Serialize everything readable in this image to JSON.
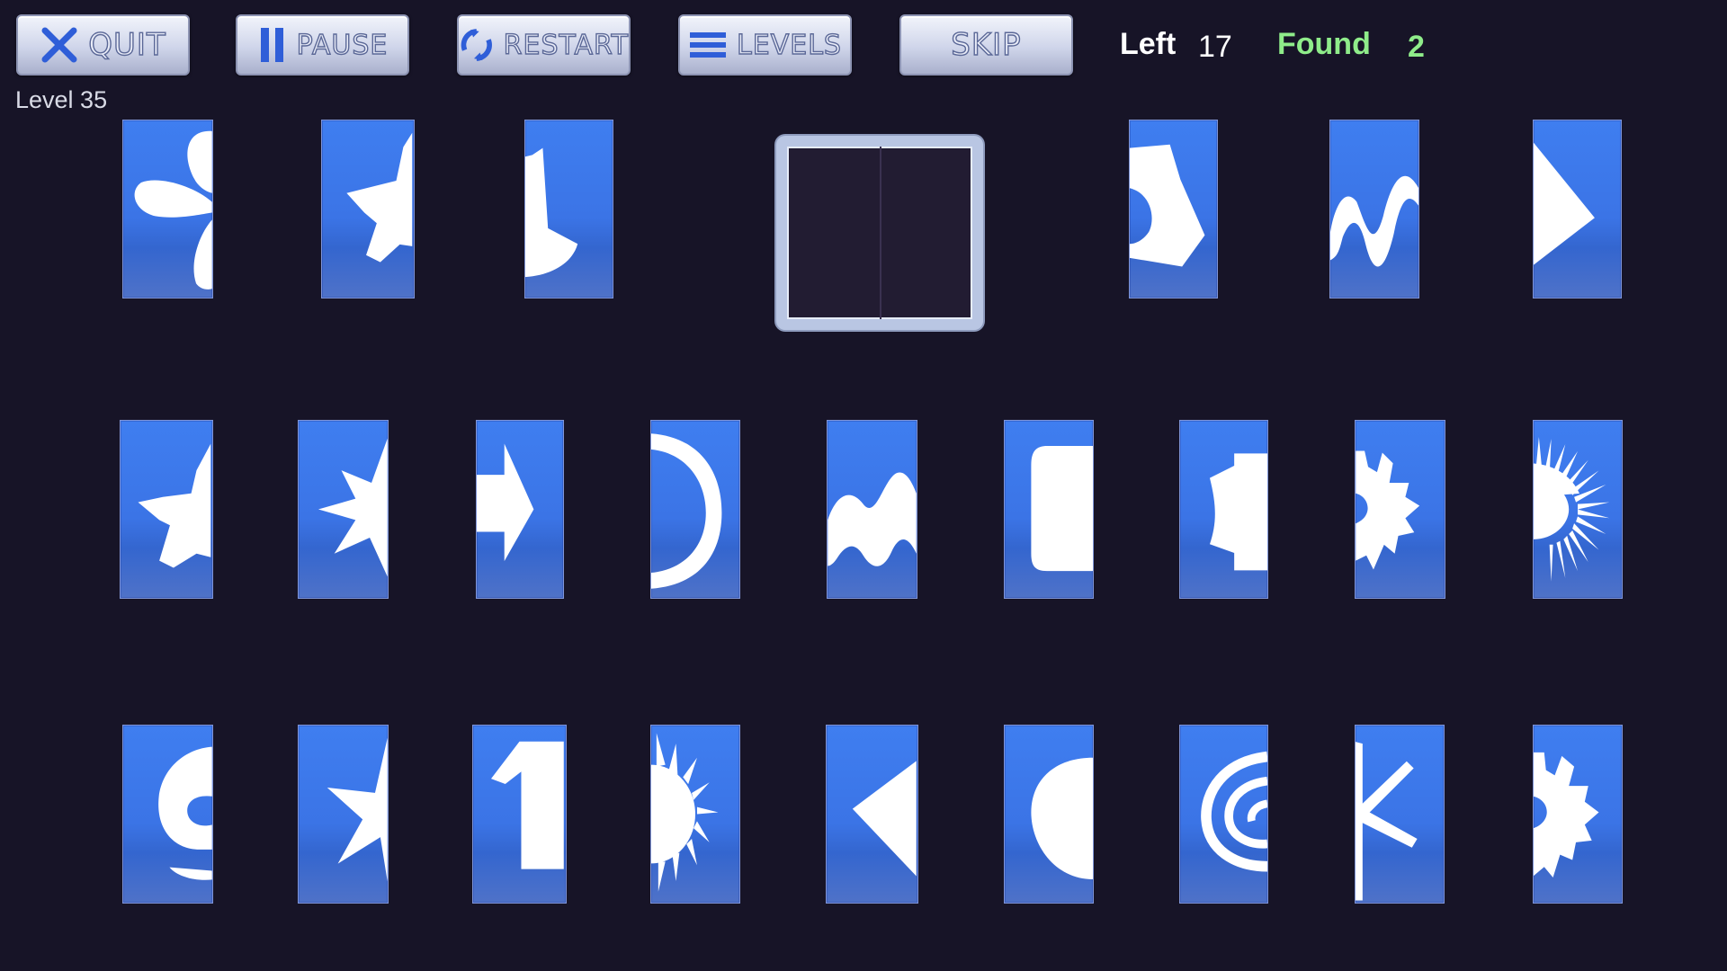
{
  "toolbar": {
    "quit_label": "QUIT",
    "pause_label": "PAUSE",
    "restart_label": "RESTART",
    "levels_label": "LEVELS",
    "skip_label": "SKIP"
  },
  "stats": {
    "left_label": "Left",
    "left_value": "17",
    "found_label": "Found",
    "found_value": "2"
  },
  "level_label": "Level 35",
  "colors": {
    "background": "#171427",
    "tile_blue": "#3b74e6",
    "found_green": "#8fec8a"
  },
  "tiles": [
    {
      "row": 1,
      "icon": "propeller-half"
    },
    {
      "row": 1,
      "icon": "star-blob-half"
    },
    {
      "row": 1,
      "icon": "pie-half"
    },
    {
      "row": 1,
      "icon": "hexagon-ring-half"
    },
    {
      "row": 1,
      "icon": "wave-half"
    },
    {
      "row": 1,
      "icon": "triangle-half"
    },
    {
      "row": 2,
      "icon": "star-blob-half"
    },
    {
      "row": 2,
      "icon": "spiky-star-half"
    },
    {
      "row": 2,
      "icon": "arrow-half"
    },
    {
      "row": 2,
      "icon": "ring-half"
    },
    {
      "row": 2,
      "icon": "wave-half"
    },
    {
      "row": 2,
      "icon": "rounded-square-half"
    },
    {
      "row": 2,
      "icon": "notched-square-half"
    },
    {
      "row": 2,
      "icon": "gear-half"
    },
    {
      "row": 2,
      "icon": "sunburst-half"
    },
    {
      "row": 3,
      "icon": "swirl-half"
    },
    {
      "row": 3,
      "icon": "star-half"
    },
    {
      "row": 3,
      "icon": "number-one-half"
    },
    {
      "row": 3,
      "icon": "sun-half"
    },
    {
      "row": 3,
      "icon": "triangle-left-half"
    },
    {
      "row": 3,
      "icon": "circle-half"
    },
    {
      "row": 3,
      "icon": "spiral-half"
    },
    {
      "row": 3,
      "icon": "asterisk-half"
    },
    {
      "row": 3,
      "icon": "gear-half"
    }
  ]
}
